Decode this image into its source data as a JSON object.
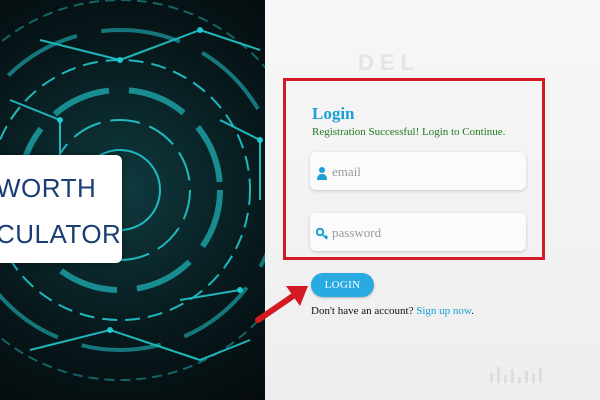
{
  "hero": {
    "line1": "WORTH",
    "line2": "CULATOR"
  },
  "background": {
    "watermark": "DEL"
  },
  "login": {
    "title": "Login",
    "message": "Registration Successful! Login to Continue.",
    "email_placeholder": "email",
    "password_placeholder": "password",
    "button_label": "LOGIN",
    "signup_prompt": "Don't have an account?",
    "signup_link": "Sign up now",
    "signup_suffix": "."
  },
  "colors": {
    "accent": "#29abe2",
    "title": "#1a9fd6",
    "success": "#1f7a1f",
    "highlight": "#d31a22"
  },
  "icons": {
    "email": "user-icon",
    "password": "key-icon",
    "annotation": "red-arrow-icon"
  }
}
